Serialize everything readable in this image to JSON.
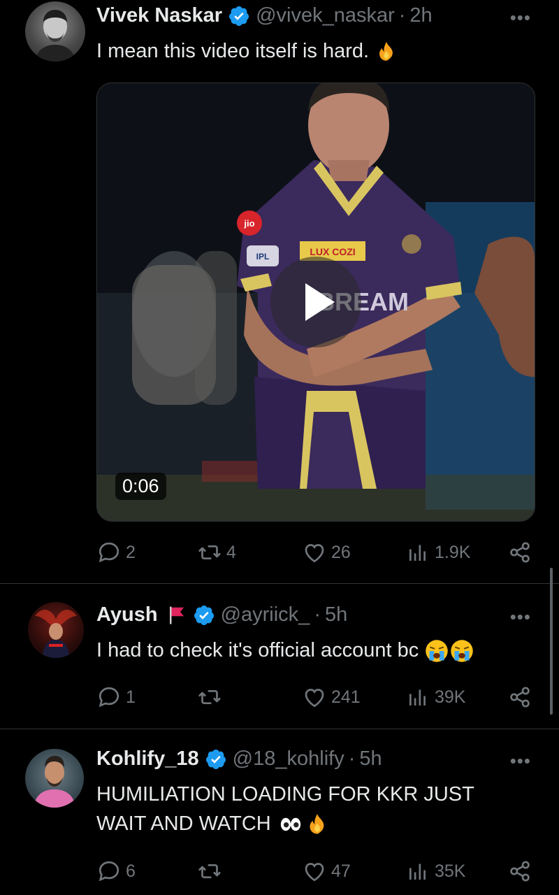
{
  "tweets": [
    {
      "name": "Vivek Naskar",
      "handle": "@vivek_naskar",
      "time": "2h",
      "text": "I mean this video itself is hard.",
      "emojis": [
        "fire"
      ],
      "video": {
        "duration": "0:06",
        "jersey_text": "LUX COZI",
        "jersey_sponsor": "BREAM",
        "sponsor_logo": "jio",
        "ipl_logo": "IPL"
      },
      "stats": {
        "replies": "2",
        "reposts": "4",
        "likes": "26",
        "views": "1.9K"
      }
    },
    {
      "name": "Ayush",
      "name_flag": "red-flag",
      "handle": "@ayriick_",
      "time": "5h",
      "text": "I had to check it's official account bc",
      "emojis": [
        "crying-face",
        "crying-face"
      ],
      "stats": {
        "replies": "1",
        "reposts": "",
        "likes": "241",
        "views": "39K"
      }
    },
    {
      "name": "Kohlify_18",
      "handle": "@18_kohlify",
      "time": "5h",
      "text_line1": "HUMILIATION LOADING FOR KKR JUST",
      "text_line2": "WAIT AND WATCH",
      "emojis": [
        "eyes",
        "fire"
      ],
      "stats": {
        "replies": "6",
        "reposts": "",
        "likes": "47",
        "views": "35K"
      }
    }
  ],
  "more_label": "•••",
  "separator": "·",
  "colors": {
    "verified": "#1d9bf0",
    "muted": "#71767b",
    "text": "#e7e9ea"
  }
}
